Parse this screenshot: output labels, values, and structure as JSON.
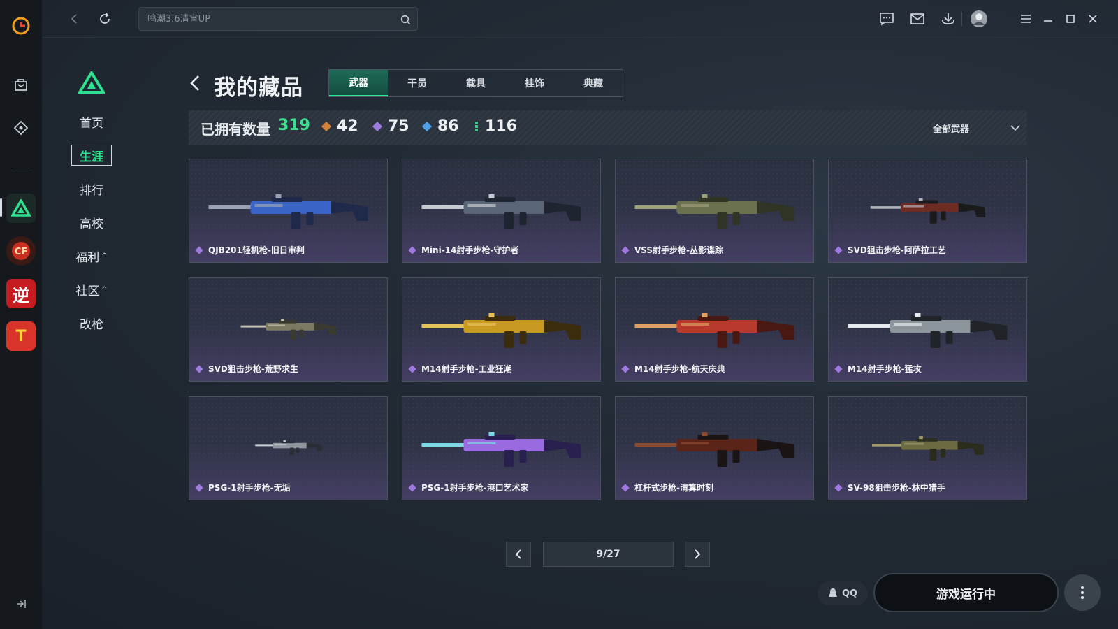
{
  "search": {
    "placeholder": "鸣潮3.6清宵UP"
  },
  "subnav": {
    "items": [
      {
        "label": "首页"
      },
      {
        "label": "生涯",
        "active": true
      },
      {
        "label": "排行"
      },
      {
        "label": "高校"
      },
      {
        "label": "福利",
        "caret": "^"
      },
      {
        "label": "社区",
        "caret": "^"
      },
      {
        "label": "改枪"
      }
    ]
  },
  "rail": {
    "games": [
      {
        "name": "active-game-icon"
      },
      {
        "name": "crossfire-icon",
        "text": ""
      },
      {
        "name": "nishuihan-icon",
        "text": "逆"
      },
      {
        "name": "tianya-icon",
        "text": "T"
      }
    ]
  },
  "page": {
    "title": "我的藏品"
  },
  "tabs": [
    {
      "label": "武器",
      "active": true
    },
    {
      "label": "干员"
    },
    {
      "label": "载具"
    },
    {
      "label": "挂饰"
    },
    {
      "label": "典藏"
    }
  ],
  "stats": {
    "label": "已拥有数量",
    "total": "319",
    "rarities": [
      {
        "value": "42",
        "color": "#d5823a"
      },
      {
        "value": "75",
        "color": "#9f7be0"
      },
      {
        "value": "86",
        "color": "#4e9ee8"
      },
      {
        "value": "116",
        "color": "#3ec88e"
      }
    ],
    "filter_label": "全部武器"
  },
  "items": [
    {
      "name": "QJB201轻机枪-旧日审判",
      "palette": [
        "#1f2a4a",
        "#3b64c8",
        "#9aa3b3"
      ]
    },
    {
      "name": "Mini-14射手步枪-守护者",
      "palette": [
        "#1e2530",
        "#5a6678",
        "#c8ccd2"
      ]
    },
    {
      "name": "VSS射手步枪-丛影谍踪",
      "palette": [
        "#2f3424",
        "#6b704e",
        "#9ea07c"
      ]
    },
    {
      "name": "SVD狙击步枪-阿萨拉工艺",
      "palette": [
        "#1a1a1c",
        "#6e2b22",
        "#b0b4ba"
      ]
    },
    {
      "name": "SVD狙击步枪-荒野求生",
      "palette": [
        "#3a3a30",
        "#7c7a60",
        "#c4c2b2"
      ]
    },
    {
      "name": "M14射手步枪-工业狂潮",
      "palette": [
        "#3a2c0c",
        "#c99a22",
        "#e5c25a"
      ]
    },
    {
      "name": "M14射手步枪-航天庆典",
      "palette": [
        "#4a1812",
        "#b83a2c",
        "#e0a060"
      ]
    },
    {
      "name": "M14射手步枪-猛攻",
      "palette": [
        "#202428",
        "#8c949c",
        "#e4e8ec"
      ]
    },
    {
      "name": "PSG-1射手步枪-无垢",
      "palette": [
        "#2a2e34",
        "#8f969e",
        "#c7ccd2"
      ]
    },
    {
      "name": "PSG-1射手步枪-港口艺术家",
      "palette": [
        "#2a2050",
        "#9a6ae0",
        "#7ed8e6"
      ]
    },
    {
      "name": "杠杆式步枪-清算时刻",
      "palette": [
        "#1a1414",
        "#5a2418",
        "#8a4a30"
      ]
    },
    {
      "name": "SV-98狙击步枪-林中猎手",
      "palette": [
        "#2a2c1e",
        "#6c6a40",
        "#a09a70"
      ]
    }
  ],
  "pagination": {
    "text": "9/27"
  },
  "bottom": {
    "qq_label": "QQ",
    "launch_label": "游戏运行中"
  }
}
